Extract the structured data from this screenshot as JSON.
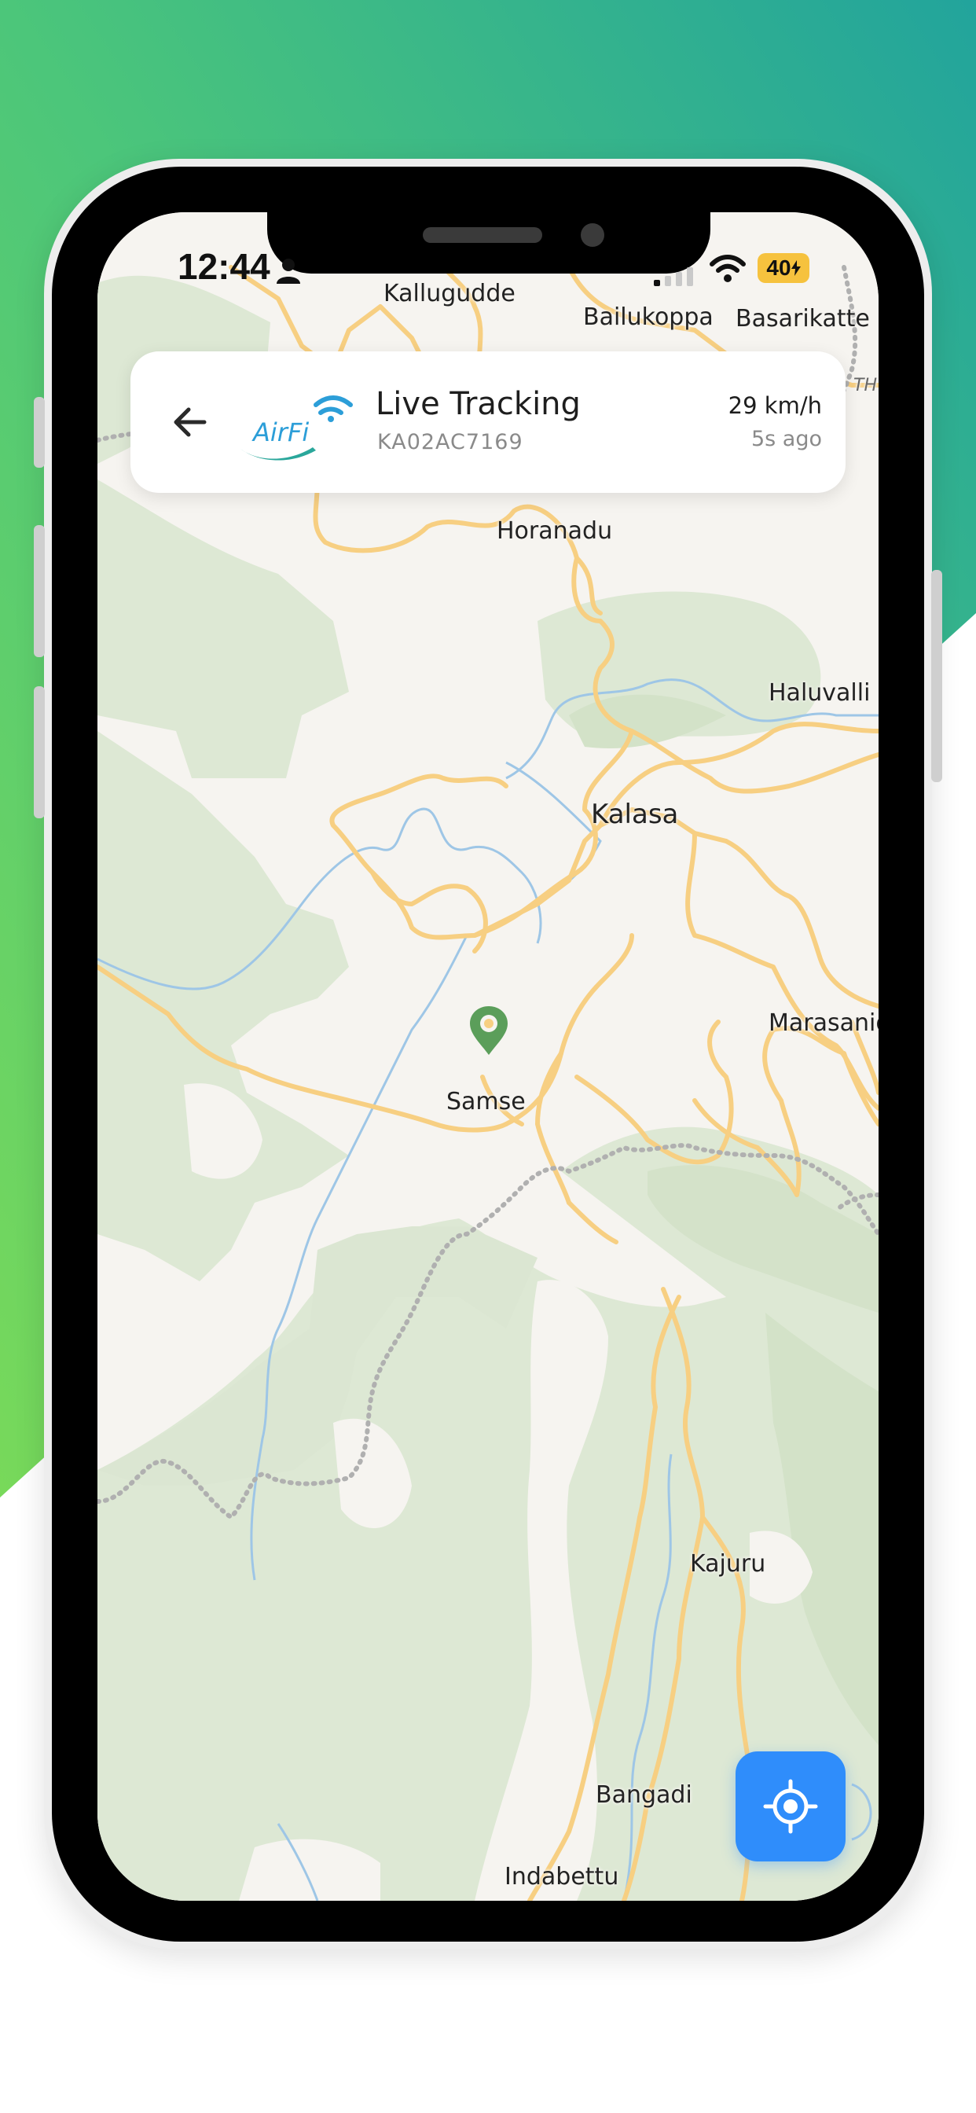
{
  "colors": {
    "gradient_start": "#5ccf68",
    "gradient_end": "#27a69a",
    "accent_blue": "#2f8dfb",
    "marker_green": "#5b9e5a",
    "map_road": "#f7cf82",
    "map_forest": "#dde8d4",
    "map_water": "#9ec6e6",
    "battery_yellow": "#f6c23e"
  },
  "status_bar": {
    "time": "12:44",
    "battery": "40"
  },
  "header": {
    "back_icon": "arrow-left-icon",
    "logo_text": "AirFi",
    "title": "Live Tracking",
    "vehicle_id": "KA02AC7169",
    "speed": "29 km/h",
    "updated": "5s ago"
  },
  "map": {
    "labels": [
      {
        "name": "Kallugudde"
      },
      {
        "name": "Bailukoppa"
      },
      {
        "name": "Basarikatte"
      },
      {
        "name": "Horanadu"
      },
      {
        "name": "Haluvalli"
      },
      {
        "name": "Kalasa"
      },
      {
        "name": "Marasanig"
      },
      {
        "name": "Samse"
      },
      {
        "name": "Kajuru"
      },
      {
        "name": "Bangadi"
      },
      {
        "name": "Indabettu"
      },
      {
        "name": "TH"
      }
    ],
    "marker_icon": "location-pin-icon"
  },
  "controls": {
    "locate_icon": "crosshair-locate-icon"
  }
}
